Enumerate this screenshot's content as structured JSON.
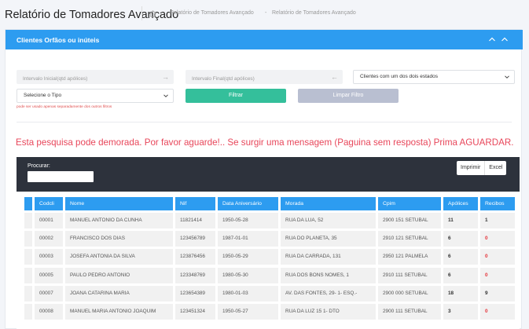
{
  "header": {
    "title": "Relatório de Tomadores Avançado",
    "breadcrumbs": [
      "Relatório de Tomadores Avançado",
      "Relatório de Tomadores Avançado"
    ],
    "home_icon": "home-icon"
  },
  "panel": {
    "title": "Clientes Orfãos ou inúteis",
    "collapse_icons": [
      "chevron-up-icon",
      "chevron-up-icon"
    ]
  },
  "filters": {
    "intervalo_inicial_placeholder": "Intervalo Inicial(qtd apólices)",
    "intervalo_final_placeholder": "Intervalo Final(qtd apólices)",
    "estado_select": "Clientes com um dos dois estados",
    "tipo_select": "Selecione o Tipo",
    "filtrar_label": "Filtrar",
    "limpar_label": "Limpar Filtro",
    "hint": "pode ser usado apenas separadamente dos outros filtros"
  },
  "warning": "Esta pesquisa pode demorada. Por favor aguarde!.. Se surgir uma mensagem (Paguina sem resposta) Prima AGUARDAR.",
  "toolbar": {
    "search_label": "Procurar:",
    "search_value": "",
    "imprimir_label": "Imprimir",
    "excel_label": "Excel"
  },
  "table": {
    "columns": [
      "",
      "Codcli",
      "Nome",
      "Nif",
      "Data Aniversário",
      "Morada",
      "Cpim",
      "Apólices",
      "Recibos"
    ],
    "rows": [
      [
        "",
        "00001",
        "MANUEL ANTONIO DA CUNHA",
        "11821414",
        "1950-05-28",
        "RUA DA LUA, 52",
        "2900 151 SETUBAL",
        "11",
        "1"
      ],
      [
        "",
        "00002",
        "FRANCISCO DOS DIAS",
        "123456789",
        "1987-01-01",
        "RUA DO PLANETA, 35",
        "2910 121 SETUBAL",
        "6",
        "0"
      ],
      [
        "",
        "00003",
        "JOSEFA ANTONIA DA SILVA",
        "123876456",
        "1950-05-29",
        "RUA DA CARRADA, 131",
        "2950 121 PALMELA",
        "6",
        "0"
      ],
      [
        "",
        "00005",
        "PAULO PEDRO ANTONIO",
        "123348769",
        "1980-05-30",
        "RUA DOS BONS NOMES, 1",
        "2910 111 SETUBAL",
        "6",
        "0"
      ],
      [
        "",
        "00007",
        "JOANA CATARINA MARIA",
        "123654389",
        "1980-01-03",
        "AV. DAS FONTES, 29- 1- ESQ.-",
        "2900 000 SETUBAL",
        "18",
        "9"
      ],
      [
        "",
        "00008",
        "MANUEL MARIA ANTONIO JOAQUIM",
        "123451324",
        "1950-05-27",
        "RUA DA LUZ 15 1- DTO",
        "2900 111 SETUBAL",
        "3",
        "0"
      ]
    ]
  },
  "colors": {
    "accent_blue": "#2d9cf0",
    "filter_green": "#34bf9b",
    "warning_red": "#e8465a",
    "dark_panel": "#2d323c"
  }
}
